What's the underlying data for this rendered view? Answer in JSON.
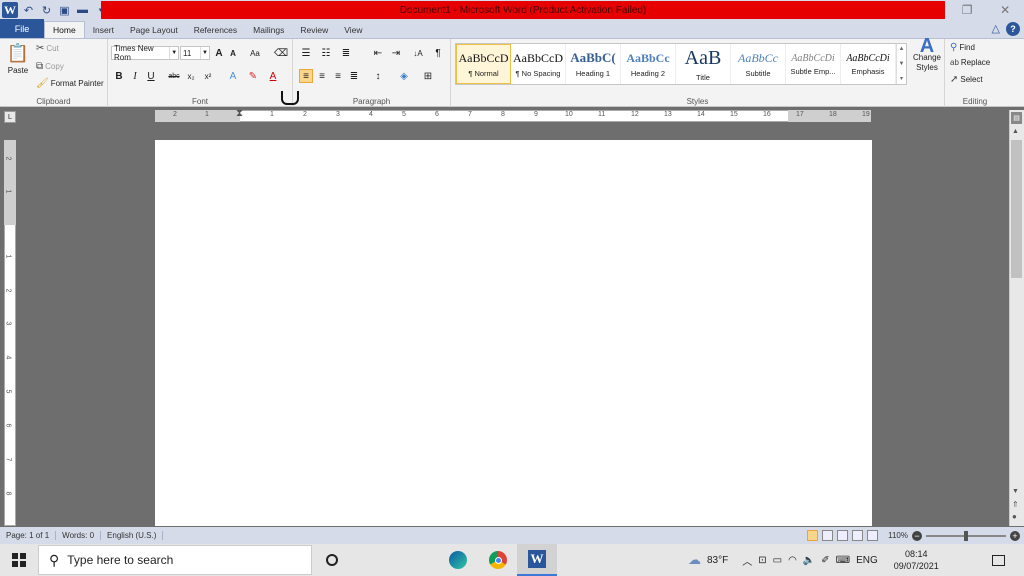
{
  "window": {
    "title": "Document1 - Microsoft Word (Product Activation Failed)"
  },
  "tabs": [
    "File",
    "Home",
    "Insert",
    "Page Layout",
    "References",
    "Mailings",
    "Review",
    "View"
  ],
  "ribbon": {
    "clipboard": {
      "label": "Clipboard",
      "paste": "Paste",
      "cut": "Cut",
      "copy": "Copy",
      "format_painter": "Format Painter"
    },
    "font": {
      "label": "Font",
      "font_name": "Times New Rom",
      "font_size": "11",
      "bold": "B",
      "italic": "I",
      "underline": "U",
      "strike": "abc",
      "subscript": "x₂",
      "superscript": "x²",
      "grow": "A",
      "shrink": "A",
      "change_case": "Aa"
    },
    "paragraph": {
      "label": "Paragraph",
      "pilcrow": "¶"
    },
    "styles": {
      "label": "Styles",
      "items": [
        {
          "preview": "AaBbCcD",
          "name": "¶ Normal",
          "color": "#111111"
        },
        {
          "preview": "AaBbCcD",
          "name": "¶ No Spacing",
          "color": "#111111"
        },
        {
          "preview": "AaBbC(",
          "name": "Heading 1",
          "color": "#365f91"
        },
        {
          "preview": "AaBbCc",
          "name": "Heading 2",
          "color": "#4f81bd"
        },
        {
          "preview": "AaB",
          "name": "Title",
          "color": "#17365d"
        },
        {
          "preview": "AaBbCc",
          "name": "Subtitle",
          "color": "#4f81bd"
        },
        {
          "preview": "AaBbCcDi",
          "name": "Subtle Emp...",
          "color": "#808080"
        },
        {
          "preview": "AaBbCcDi",
          "name": "Emphasis",
          "color": "#111111"
        }
      ],
      "change_styles": "Change Styles"
    },
    "editing": {
      "label": "Editing",
      "find": "Find",
      "replace": "Replace",
      "select": "Select"
    }
  },
  "ruler": {
    "h_ticks": [
      "2",
      "1",
      "1",
      "2",
      "3",
      "4",
      "5",
      "6",
      "7",
      "8",
      "9",
      "10",
      "11",
      "12",
      "13",
      "14",
      "15",
      "16",
      "17",
      "18",
      "19"
    ],
    "v_ticks": [
      "2",
      "1",
      "1",
      "2",
      "3",
      "4",
      "5",
      "6",
      "7",
      "8"
    ]
  },
  "status": {
    "page": "Page: 1 of 1",
    "words": "Words: 0",
    "language": "English (U.S.)",
    "zoom": "110%"
  },
  "taskbar": {
    "search_placeholder": "Type here to search",
    "temperature": "83°F",
    "language": "ENG",
    "time": "08:14",
    "date": "09/07/2021"
  },
  "colors": {
    "title_bar_warning": "#e60000",
    "file_tab": "#2b579a",
    "highlight": "#fbd58a"
  }
}
